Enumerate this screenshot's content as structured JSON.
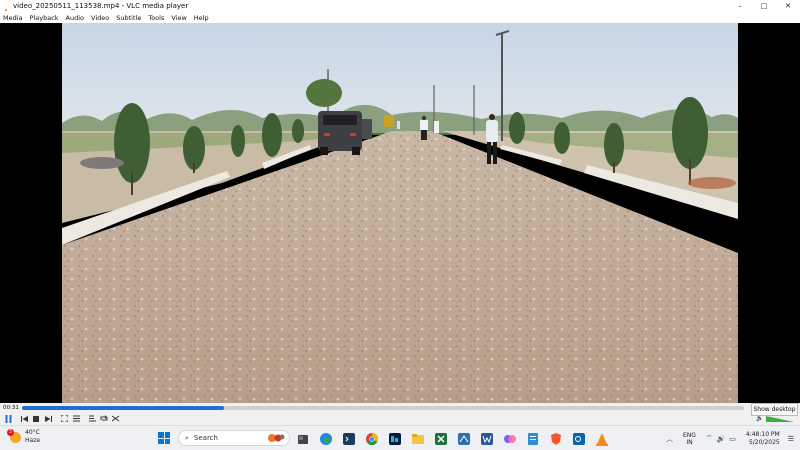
{
  "window": {
    "title": "video_20250511_113538.mp4 - VLC media player",
    "app_icon": "vlc-cone-icon",
    "buttons": {
      "minimize": "–",
      "maximize": "□",
      "close": "✕"
    }
  },
  "menu": [
    "Media",
    "Playback",
    "Audio",
    "Video",
    "Subtitle",
    "Tools",
    "View",
    "Help"
  ],
  "player": {
    "elapsed": "00:31",
    "progress_fraction": 0.28,
    "volume_fraction": 1.0,
    "controls": [
      "pause-icon",
      "previous-icon",
      "stop-icon",
      "next-icon",
      "fullscreen-icon",
      "extended-settings-icon",
      "playlist-icon",
      "loop-icon",
      "shuffle-icon"
    ],
    "accent": "#1f6fd0"
  },
  "tooltip": "Show desktop",
  "taskbar": {
    "weather": {
      "temp": "40°C",
      "condition": "Haze",
      "badge": "5"
    },
    "search_placeholder": "Search",
    "apps": [
      "file-explorer-icon",
      "edge-icon",
      "terminal-icon",
      "chrome-icon",
      "photoshop-icon",
      "folder-icon",
      "excel-icon",
      "app-icon",
      "word-icon",
      "copilot-icon",
      "notepad-icon",
      "brave-icon",
      "outlook-icon",
      "vlc-icon"
    ],
    "lang_line1": "ENG",
    "lang_line2": "IN",
    "time": "4:48:10 PM",
    "date": "5/20/2025"
  }
}
